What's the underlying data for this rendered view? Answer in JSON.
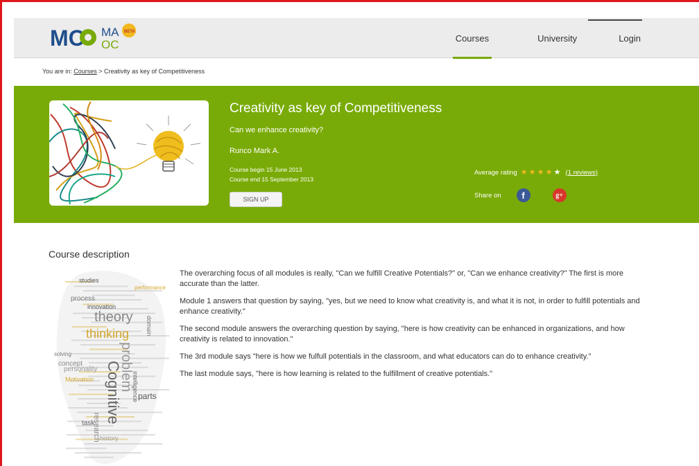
{
  "brand": {
    "logo_top_left": "MO",
    "logo_top_right": "MA",
    "logo_bottom_right": "OC",
    "logo_badge": "BETA"
  },
  "nav": {
    "courses": "Courses",
    "university": "University",
    "login": "Login"
  },
  "breadcrumb": {
    "prefix": "You are in:",
    "link": "Courses",
    "separator": ">",
    "current": "Creativity as key of Competitiveness"
  },
  "course": {
    "title": "Creativity as key of Competitiveness",
    "subtitle": "Can we enhance creativity?",
    "author": "Runco Mark A.",
    "begin": "Course begin 15 June 2013",
    "end": "Course end 15 September 2013",
    "signup_label": "SIGN UP",
    "rating_label": "Average rating",
    "rating_value": 4,
    "rating_max": 5,
    "reviews_label": "(1 reviews)",
    "share_label": "Share on",
    "facebook_glyph": "f",
    "google_glyph": "g+"
  },
  "description": {
    "title": "Course description",
    "paragraphs": [
      "The overarching focus of all modules is really, \"Can we fulfill Creative Potentials?\"  or, \"Can we enhance creativity?\"  The first is more accurate than the latter.",
      "Module 1 answers that question by saying, \"yes, but we need to know what creativity is, and what it is not, in order to fulfill potentials and enhance creativity.\"",
      "The second module answers the overarching question by saying, \"here is how creativity can be enhanced in organizations, and how creativity is related to innovation.\"",
      "The 3rd module says \"here is how we fulfull potentials in the classroom, and what educators can do to enhance creativity.\"",
      "The last module says, \"here is how learning is related to the fulfillment of creative potentials.\""
    ]
  },
  "word_cloud": {
    "words": [
      "studies",
      "process",
      "theory",
      "thinking",
      "problem",
      "Cognitive",
      "innovation",
      "solving",
      "concept",
      "Motivation",
      "personality",
      "intelligence",
      "parts",
      "domain",
      "research",
      "performance",
      "history",
      "task"
    ]
  },
  "colors": {
    "accent_green": "#79ab08",
    "frame_red": "#e0161c",
    "header_gray": "#ececec",
    "star_gold": "#f2b81f",
    "facebook_blue": "#3b5998",
    "google_red": "#d7372b"
  }
}
